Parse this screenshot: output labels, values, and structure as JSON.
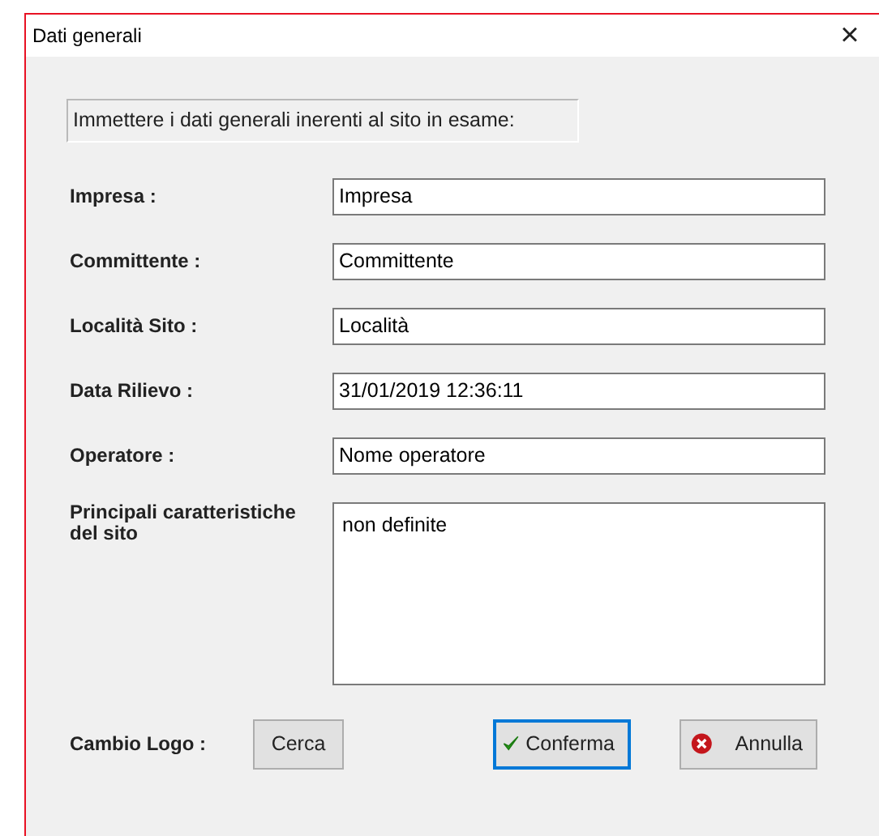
{
  "window": {
    "title": "Dati generali",
    "close": "×"
  },
  "instruction": "Immettere i dati generali inerenti al sito in esame:",
  "fields": [
    {
      "label": "Impresa :",
      "value": "Impresa"
    },
    {
      "label": "Committente :",
      "value": "Committente"
    },
    {
      "label": "Località Sito :",
      "value": "Località"
    },
    {
      "label": "Data Rilievo :",
      "value": "31/01/2019 12:36:11"
    },
    {
      "label": "Operatore :",
      "value": "Nome operatore"
    }
  ],
  "notes": {
    "label": "Principali caratteristiche del sito",
    "value": "non definite"
  },
  "logo": {
    "label": "Cambio Logo :",
    "button": "Cerca"
  },
  "buttons": [
    {
      "kind": "confirm",
      "label": "Conferma",
      "focused": true
    },
    {
      "kind": "cancel",
      "label": "Annulla",
      "focused": false
    }
  ]
}
